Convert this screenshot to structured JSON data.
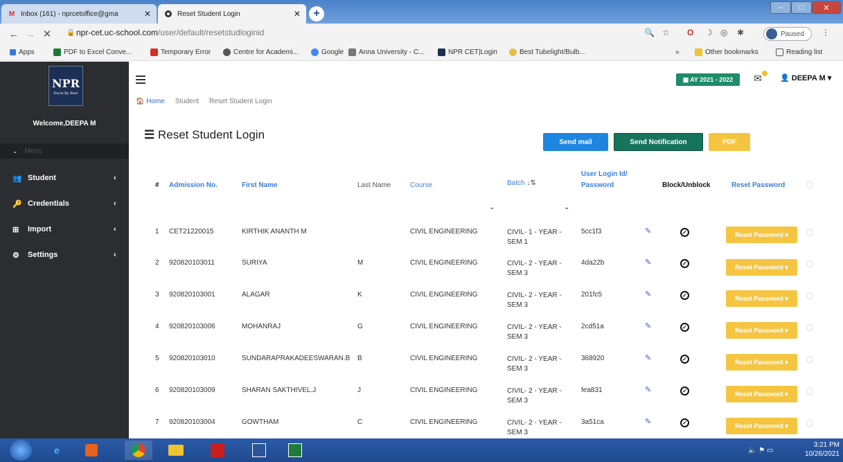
{
  "browser": {
    "tabs": [
      {
        "title": "Inbox (161) - nprcetoffice@gma",
        "icon": "gmail-icon",
        "active": false
      },
      {
        "title": "Reset Student Login",
        "icon": "site-icon",
        "active": true
      }
    ],
    "url_domain": "npr-cet.uc-school.com",
    "url_path": "/user/default/resetstudloginid",
    "paused_label": "Paused",
    "bookmarks": [
      "Apps",
      "PDF to Excel Conve...",
      "Temporary Error",
      "Centre for Academi...",
      "Google",
      "Anna University - C...",
      "NPR CET|Login",
      "Best Tubelight/Bulb..."
    ],
    "other_bookmarks": "Other bookmarks",
    "reading_list": "Reading list",
    "overflow": "»"
  },
  "sidebar": {
    "logo_text": "NPR",
    "logo_tagline": "Excel By Best",
    "welcome": "Welcome,DEEPA M",
    "menu_head": "Menu",
    "items": [
      {
        "label": "Student",
        "icon": "users-icon"
      },
      {
        "label": "Credentials",
        "icon": "key-icon"
      },
      {
        "label": "Import",
        "icon": "import-icon"
      },
      {
        "label": "Settings",
        "icon": "gear-icon"
      }
    ]
  },
  "header": {
    "academic_year": "AY 2021 - 2022",
    "user_name": "DEEPA M"
  },
  "breadcrumb": [
    "Home",
    "Student",
    "Reset Student Login"
  ],
  "page": {
    "title": "Reset Student Login",
    "buttons": {
      "send_mail": "Send mail",
      "send_notification": "Send Notification",
      "pdf": "PDF"
    }
  },
  "table": {
    "headers": {
      "num": "#",
      "admission": "Admission No.",
      "first_name": "First Name",
      "last_name": "Last Name",
      "course": "Course",
      "batch": "Batch",
      "login_line1": "User Login Id/",
      "login_line2": "Password",
      "block": "Block/Unblock",
      "reset": "Reset Password"
    },
    "reset_button_label": "Reset Password ▾",
    "rows": [
      {
        "num": "1",
        "admission": "CET21220015",
        "first_name": "KIRTHIK ANANTH M",
        "last_name": "",
        "course": "CIVIL ENGINEERING",
        "batch": "CIVIL- 1 - YEAR - SEM 1",
        "password": "5cc1f3"
      },
      {
        "num": "2",
        "admission": "920820103011",
        "first_name": "SURIYA",
        "last_name": "M",
        "course": "CIVIL ENGINEERING",
        "batch": "CIVIL- 2 - YEAR - SEM 3",
        "password": "4da22b"
      },
      {
        "num": "3",
        "admission": "920820103001",
        "first_name": "ALAGAR",
        "last_name": "K",
        "course": "CIVIL ENGINEERING",
        "batch": "CIVIL- 2 - YEAR - SEM 3",
        "password": "201fc5"
      },
      {
        "num": "4",
        "admission": "920820103006",
        "first_name": "MOHANRAJ",
        "last_name": "G",
        "course": "CIVIL ENGINEERING",
        "batch": "CIVIL- 2 - YEAR - SEM 3",
        "password": "2cd51a"
      },
      {
        "num": "5",
        "admission": "920820103010",
        "first_name": "SUNDARAPRAKADEESWARAN.B",
        "last_name": "B",
        "course": "CIVIL ENGINEERING",
        "batch": "CIVIL- 2 - YEAR - SEM 3",
        "password": "368920"
      },
      {
        "num": "6",
        "admission": "920820103009",
        "first_name": "SHARAN SAKTHIVEL.J",
        "last_name": "J",
        "course": "CIVIL ENGINEERING",
        "batch": "CIVIL- 2 - YEAR - SEM 3",
        "password": "fea831"
      },
      {
        "num": "7",
        "admission": "920820103004",
        "first_name": "GOWTHAM",
        "last_name": "C",
        "course": "CIVIL ENGINEERING",
        "batch": "CIVIL- 2 - YEAR - SEM 3",
        "password": "3a51ca"
      }
    ]
  },
  "taskbar": {
    "time": "3:21 PM",
    "date": "10/26/2021"
  }
}
